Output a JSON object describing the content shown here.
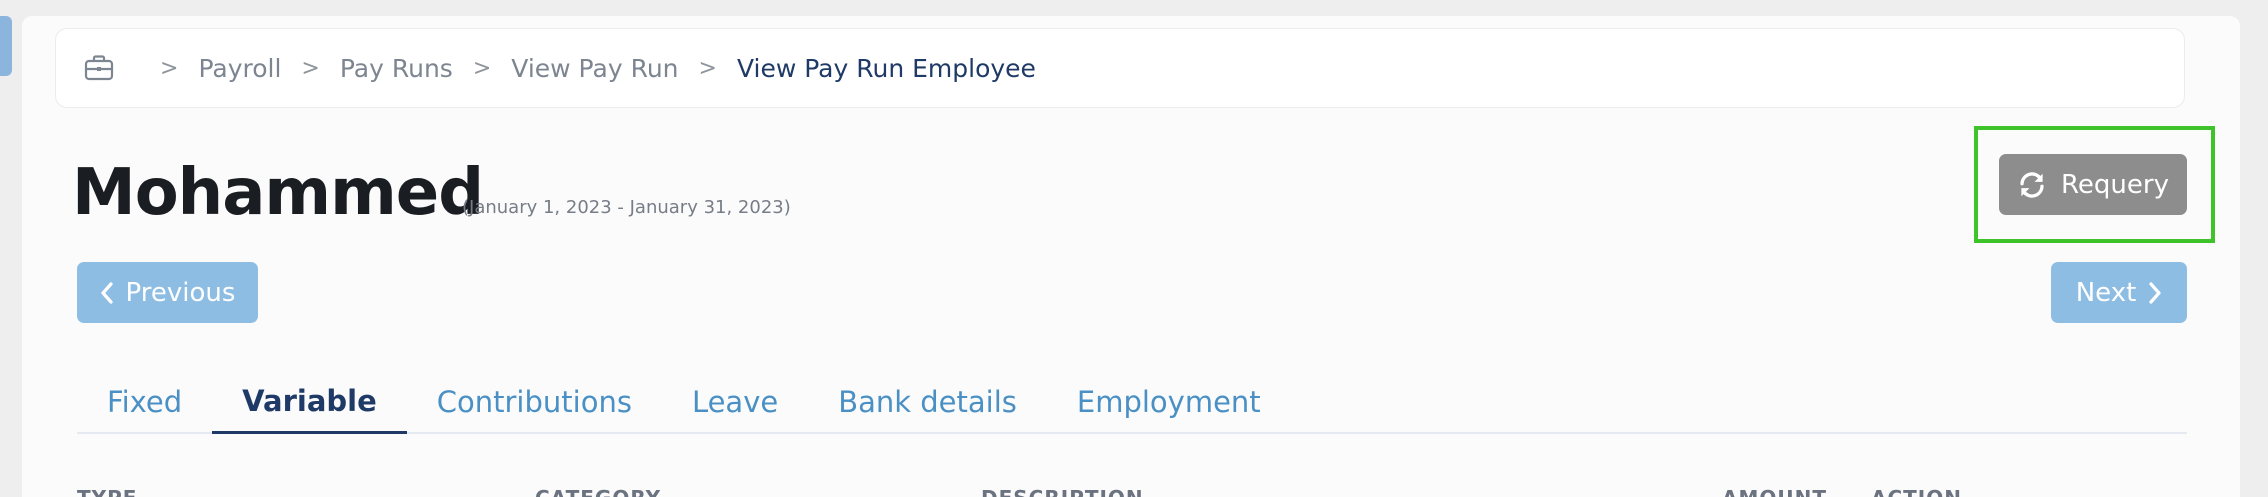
{
  "breadcrumb": {
    "icon": "briefcase-icon",
    "items": [
      "Payroll",
      "Pay Runs",
      "View Pay Run",
      "View Pay Run Employee"
    ]
  },
  "header": {
    "title": "Mohammed",
    "period": "(January 1, 2023 - January 31, 2023)"
  },
  "actions": {
    "requery_label": "Requery",
    "previous_label": "Previous",
    "next_label": "Next"
  },
  "tabs": [
    {
      "label": "Fixed",
      "active": false
    },
    {
      "label": "Variable",
      "active": true
    },
    {
      "label": "Contributions",
      "active": false
    },
    {
      "label": "Leave",
      "active": false
    },
    {
      "label": "Bank details",
      "active": false
    },
    {
      "label": "Employment",
      "active": false
    }
  ],
  "table": {
    "columns": [
      "TYPE",
      "CATEGORY",
      "DESCRIPTION",
      "AMOUNT",
      "ACTION"
    ]
  },
  "colors": {
    "accent": "#1f3a66",
    "link": "#4a90c4",
    "nav_button": "#8ebde3",
    "requery_button": "#8d8d8d",
    "highlight": "#3ec42a"
  }
}
